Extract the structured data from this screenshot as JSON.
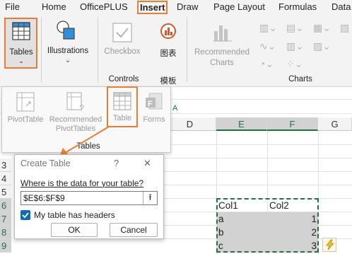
{
  "tabs": [
    "File",
    "Home",
    "OfficePLUS",
    "Insert",
    "Draw",
    "Page Layout",
    "Formulas",
    "Data"
  ],
  "ribbon": {
    "tables_label": "Tables",
    "illustrations_label": "Illustrations",
    "checkbox_label": "Checkbox",
    "chinese_button_label": "图表",
    "recommended_charts_label": "Recommended\nCharts",
    "controls_group_label": "Controls",
    "chinese_group_label": "模板",
    "charts_group_label": "Charts"
  },
  "tables_popup": {
    "pivottable_label": "PivotTable",
    "recommended_pivottables_label": "Recommended\nPivotTables",
    "table_label": "Table",
    "forms_label": "Forms",
    "group_label": "Tables"
  },
  "sheet": {
    "columns": [
      "D",
      "E",
      "F",
      "G"
    ],
    "rows": [
      "3",
      "4",
      "5",
      "6",
      "7",
      "8",
      "9"
    ],
    "cells": {
      "E6": "Col1",
      "F6": "Col2",
      "E7": "a",
      "F7": "1",
      "E8": "b",
      "F8": "2",
      "E9": "c",
      "F9": "3"
    }
  },
  "dialog": {
    "title": "Create Table",
    "help": "?",
    "close": "✕",
    "question": "Where is the data for your table?",
    "range_value": "$E$6:$F$9",
    "checkbox_label": "My table has headers",
    "ok": "OK",
    "cancel": "Cancel"
  },
  "colors": {
    "accent_orange": "#ed7d31",
    "selection_gray": "#d2d2d2",
    "excel_green": "#217346",
    "checkbox_blue": "#0f6cbd",
    "quick_analysis_yellow": "#f2c12e"
  }
}
